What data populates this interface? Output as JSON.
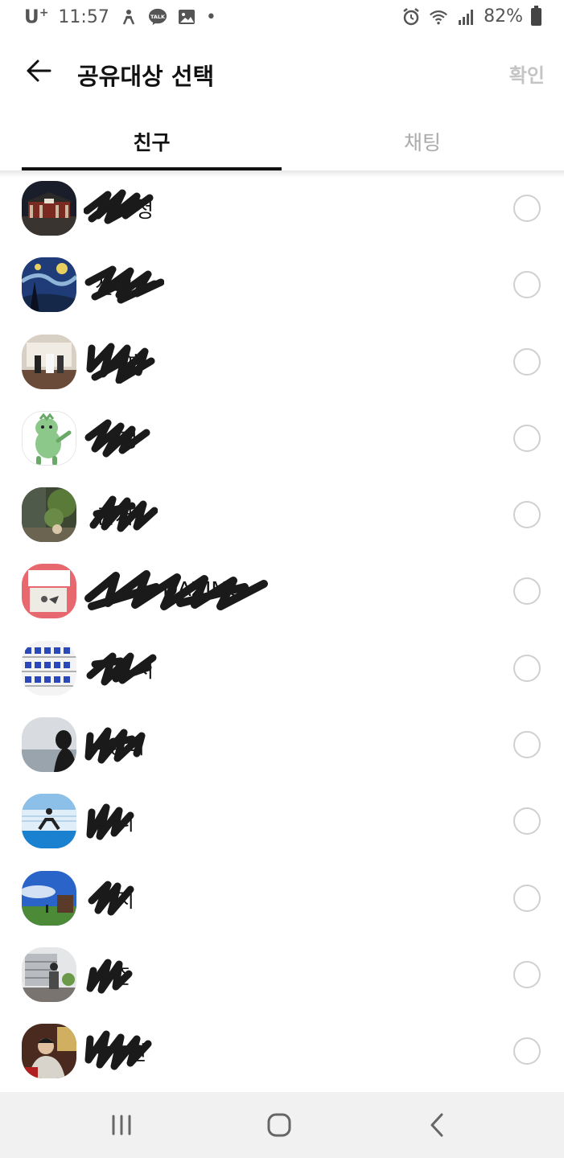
{
  "status_bar": {
    "carrier": "U",
    "carrier_plus": "+",
    "time": "11:57",
    "dot": "•",
    "battery": "82%",
    "icons": [
      "accessibility-icon",
      "kakaotalk-icon",
      "gallery-icon",
      "alarm-icon",
      "wifi-icon",
      "signal-icon",
      "battery-icon"
    ]
  },
  "header": {
    "title": "공유대상 선택",
    "confirm_label": "확인"
  },
  "tabs": [
    {
      "label": "친구",
      "selected": true
    },
    {
      "label": "채팅",
      "selected": false
    }
  ],
  "friends": [
    {
      "name": "정",
      "avatar": "palace-photo"
    },
    {
      "name": "선녀",
      "avatar": "starry-night-painting"
    },
    {
      "name": "영",
      "avatar": "wedding-photo"
    },
    {
      "name": "정",
      "avatar": "green-dinosaur-illustration"
    },
    {
      "name": "준서",
      "avatar": "garden-photo"
    },
    {
      "name": "DAZIMe",
      "avatar": "red-sign-photo"
    },
    {
      "name": "서",
      "avatar": "blue-pattern-photo"
    },
    {
      "name": "영이",
      "avatar": "sea-silhouette-photo"
    },
    {
      "name": "니",
      "avatar": "playground-photo"
    },
    {
      "name": "지",
      "avatar": "sky-field-photo"
    },
    {
      "name": "준",
      "avatar": "building-photo"
    },
    {
      "name": "한",
      "avatar": "person-dining-photo"
    }
  ],
  "colors": {
    "accent": "#111111",
    "inactive": "#aaaaaa",
    "radio_border": "#d0d0d0",
    "nav_bg": "#f1f1f1"
  }
}
